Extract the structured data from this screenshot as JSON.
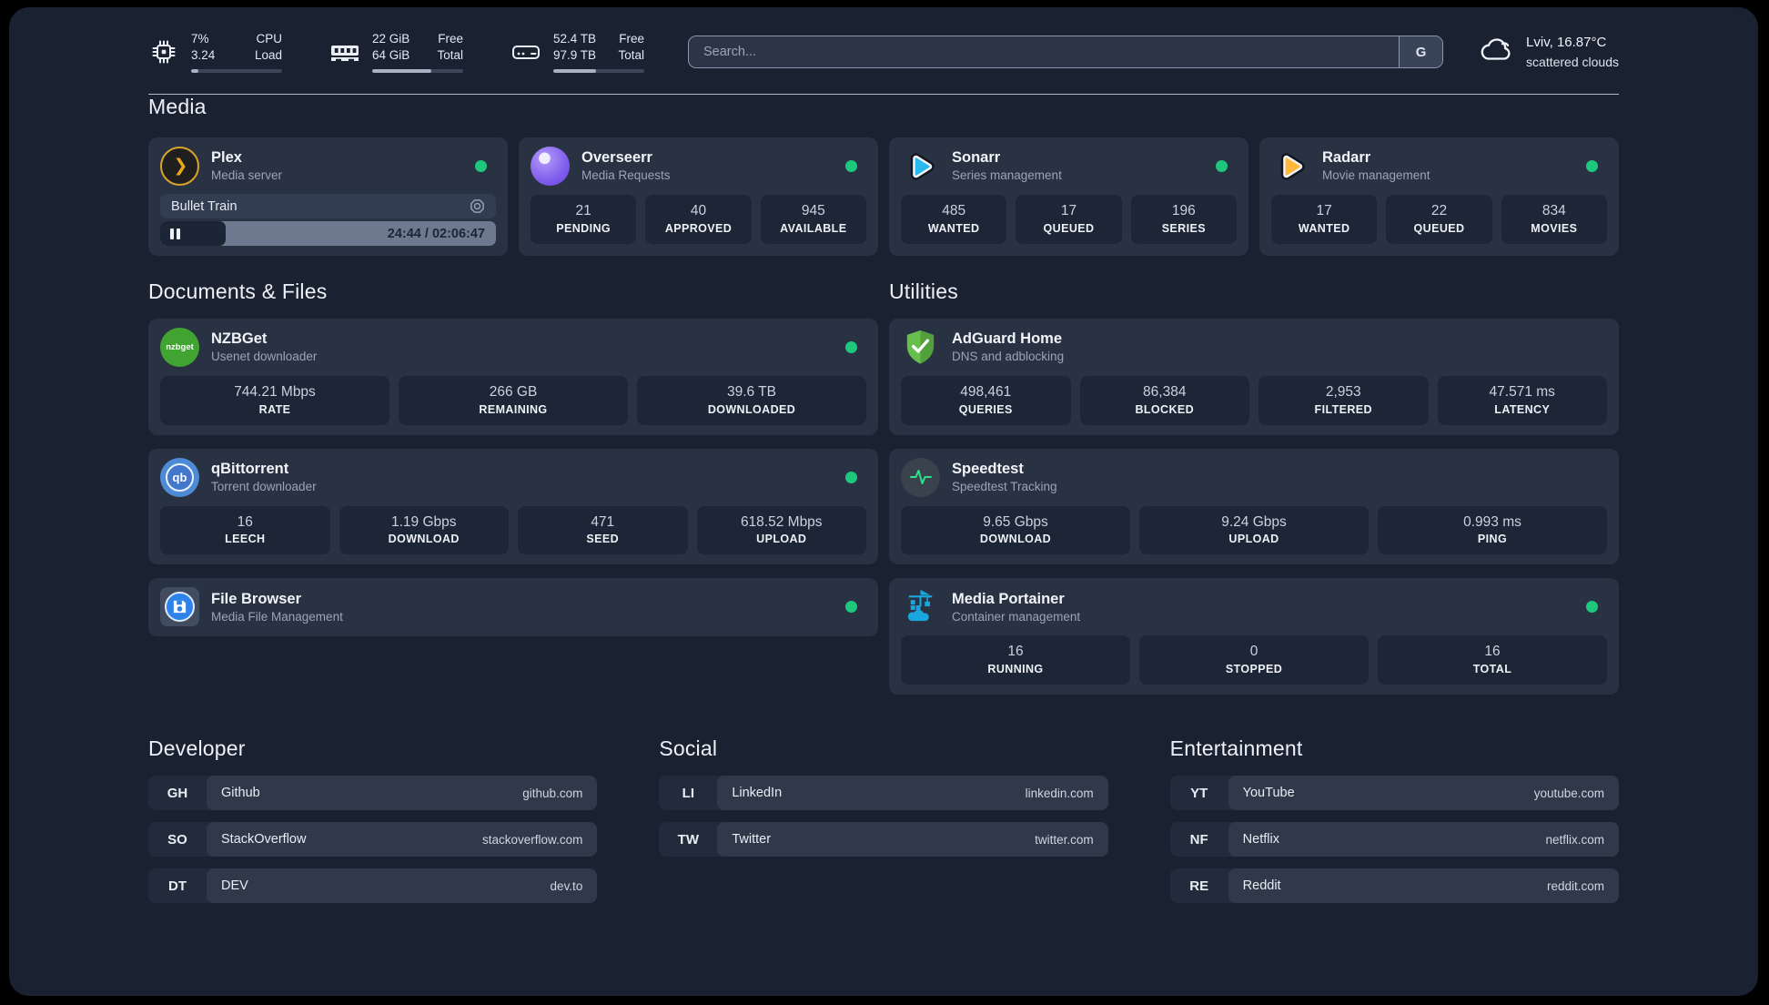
{
  "colors": {
    "page_bg": "#1a2232",
    "card_bg": "#293242",
    "pill_bg": "#1d2637",
    "status_online": "#1dc87d",
    "accent_progress": "#a8b1c2"
  },
  "header": {
    "metrics": [
      {
        "icon": "cpu-icon",
        "value_top": "7%",
        "value_bottom": "3.24",
        "label_top": "CPU",
        "label_bottom": "Load",
        "progress_pct": 8
      },
      {
        "icon": "ram-icon",
        "value_top": "22 GiB",
        "value_bottom": "64 GiB",
        "label_top": "Free",
        "label_bottom": "Total",
        "progress_pct": 65
      },
      {
        "icon": "disk-icon",
        "value_top": "52.4 TB",
        "value_bottom": "97.9 TB",
        "label_top": "Free",
        "label_bottom": "Total",
        "progress_pct": 47
      }
    ],
    "search": {
      "placeholder": "Search...",
      "button_label": "G"
    },
    "weather": {
      "icon": "cloud-icon",
      "location_temp": "Lviv, 16.87°C",
      "condition": "scattered clouds"
    }
  },
  "sections": {
    "media": {
      "title": "Media",
      "plex": {
        "name": "Plex",
        "description": "Media server",
        "online": true,
        "player": {
          "title": "Bullet Train",
          "state": "paused",
          "time": "24:44 / 02:06:47",
          "progress_pct": 19.5
        }
      },
      "overseerr": {
        "name": "Overseerr",
        "description": "Media Requests",
        "online": true,
        "stats": [
          {
            "value": "21",
            "label": "PENDING"
          },
          {
            "value": "40",
            "label": "APPROVED"
          },
          {
            "value": "945",
            "label": "AVAILABLE"
          }
        ]
      },
      "sonarr": {
        "name": "Sonarr",
        "description": "Series management",
        "online": true,
        "stats": [
          {
            "value": "485",
            "label": "WANTED"
          },
          {
            "value": "17",
            "label": "QUEUED"
          },
          {
            "value": "196",
            "label": "SERIES"
          }
        ]
      },
      "radarr": {
        "name": "Radarr",
        "description": "Movie management",
        "online": true,
        "stats": [
          {
            "value": "17",
            "label": "WANTED"
          },
          {
            "value": "22",
            "label": "QUEUED"
          },
          {
            "value": "834",
            "label": "MOVIES"
          }
        ]
      }
    },
    "documents": {
      "title": "Documents & Files",
      "nzbget": {
        "name": "NZBGet",
        "description": "Usenet downloader",
        "online": true,
        "stats": [
          {
            "value": "744.21 Mbps",
            "label": "RATE"
          },
          {
            "value": "266 GB",
            "label": "REMAINING"
          },
          {
            "value": "39.6 TB",
            "label": "DOWNLOADED"
          }
        ]
      },
      "qbittorrent": {
        "name": "qBittorrent",
        "description": "Torrent downloader",
        "online": true,
        "stats": [
          {
            "value": "16",
            "label": "LEECH"
          },
          {
            "value": "1.19 Gbps",
            "label": "DOWNLOAD"
          },
          {
            "value": "471",
            "label": "SEED"
          },
          {
            "value": "618.52 Mbps",
            "label": "UPLOAD"
          }
        ]
      },
      "filebrowser": {
        "name": "File Browser",
        "description": "Media File Management",
        "online": true
      }
    },
    "utilities": {
      "title": "Utilities",
      "adguard": {
        "name": "AdGuard Home",
        "description": "DNS and adblocking",
        "stats": [
          {
            "value": "498,461",
            "label": "QUERIES"
          },
          {
            "value": "86,384",
            "label": "BLOCKED"
          },
          {
            "value": "2,953",
            "label": "FILTERED"
          },
          {
            "value": "47.571 ms",
            "label": "LATENCY"
          }
        ]
      },
      "speedtest": {
        "name": "Speedtest",
        "description": "Speedtest Tracking",
        "stats": [
          {
            "value": "9.65 Gbps",
            "label": "DOWNLOAD"
          },
          {
            "value": "9.24 Gbps",
            "label": "UPLOAD"
          },
          {
            "value": "0.993 ms",
            "label": "PING"
          }
        ]
      },
      "portainer": {
        "name": "Media Portainer",
        "description": "Container management",
        "online": true,
        "stats": [
          {
            "value": "16",
            "label": "RUNNING"
          },
          {
            "value": "0",
            "label": "STOPPED"
          },
          {
            "value": "16",
            "label": "TOTAL"
          }
        ]
      }
    },
    "links": {
      "developer": {
        "title": "Developer",
        "items": [
          {
            "abbr": "GH",
            "name": "Github",
            "url": "github.com"
          },
          {
            "abbr": "SO",
            "name": "StackOverflow",
            "url": "stackoverflow.com"
          },
          {
            "abbr": "DT",
            "name": "DEV",
            "url": "dev.to"
          }
        ]
      },
      "social": {
        "title": "Social",
        "items": [
          {
            "abbr": "LI",
            "name": "LinkedIn",
            "url": "linkedin.com"
          },
          {
            "abbr": "TW",
            "name": "Twitter",
            "url": "twitter.com"
          }
        ]
      },
      "entertainment": {
        "title": "Entertainment",
        "items": [
          {
            "abbr": "YT",
            "name": "YouTube",
            "url": "youtube.com"
          },
          {
            "abbr": "NF",
            "name": "Netflix",
            "url": "netflix.com"
          },
          {
            "abbr": "RE",
            "name": "Reddit",
            "url": "reddit.com"
          }
        ]
      }
    }
  }
}
